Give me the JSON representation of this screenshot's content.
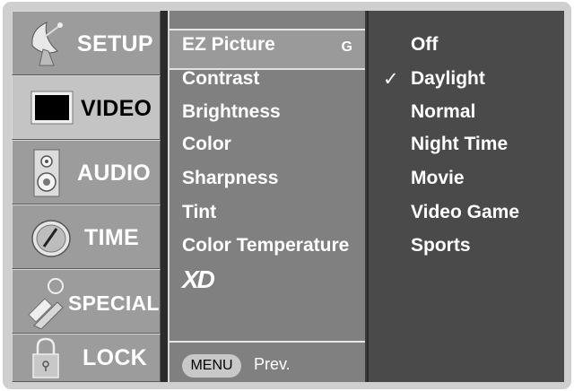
{
  "nav": {
    "items": [
      {
        "label": "SETUP",
        "icon": "satellite-dish-icon"
      },
      {
        "label": "VIDEO",
        "icon": "tv-screen-icon"
      },
      {
        "label": "AUDIO",
        "icon": "speaker-icon"
      },
      {
        "label": "TIME",
        "icon": "clock-icon"
      },
      {
        "label": "SPECIAL",
        "icon": "key-icon"
      },
      {
        "label": "LOCK",
        "icon": "padlock-icon"
      }
    ],
    "active": "VIDEO"
  },
  "menu": {
    "items": [
      "EZ Picture",
      "Contrast",
      "Brightness",
      "Color",
      "Sharpness",
      "Tint",
      "Color Temperature"
    ],
    "selected": "EZ Picture",
    "selected_hint": "G",
    "logo": "XD",
    "footer_button": "MENU",
    "footer_text": "Prev."
  },
  "options": {
    "items": [
      "Off",
      "Daylight",
      "Normal",
      "Night Time",
      "Movie",
      "Video Game",
      "Sports"
    ],
    "checked": "Daylight",
    "check_mark": "✓"
  }
}
